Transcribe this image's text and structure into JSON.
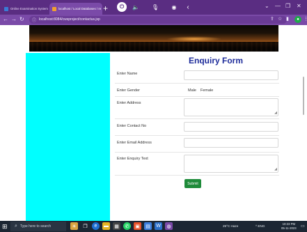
{
  "browser": {
    "tabs": [
      {
        "label": "Online Examination System",
        "active": false
      },
      {
        "label": "localhost / Local Databases / re",
        "active": true
      }
    ],
    "new_tab": "+",
    "url": "localhost:8084/cwsproject/contactus.jsp",
    "window_controls": {
      "minimize": "—",
      "restore": "❐",
      "close": "✕"
    }
  },
  "form": {
    "title": "Enquiry Form",
    "fields": {
      "name_label": "Enter Name",
      "gender_label": "Enter Gender",
      "gender_options": [
        "Male",
        "Female"
      ],
      "address_label": "Enter Address",
      "contact_label": "Enter Contact No",
      "email_label": "Enter Email Address",
      "enquiry_label": "Enter Enquiry Text"
    },
    "submit_label": "Submit"
  },
  "taskbar": {
    "search_placeholder": "Type here to search",
    "weather": "29°C Haze",
    "tray_text": "^ ENG",
    "time": "10:23 PM",
    "date": "05-11-2023"
  },
  "colors": {
    "browser_frame": "#5a2d82",
    "sidebar": "#00ffff",
    "title": "#1d2b9a",
    "submit": "#1f8b3a",
    "taskbar": "#1c2633"
  }
}
